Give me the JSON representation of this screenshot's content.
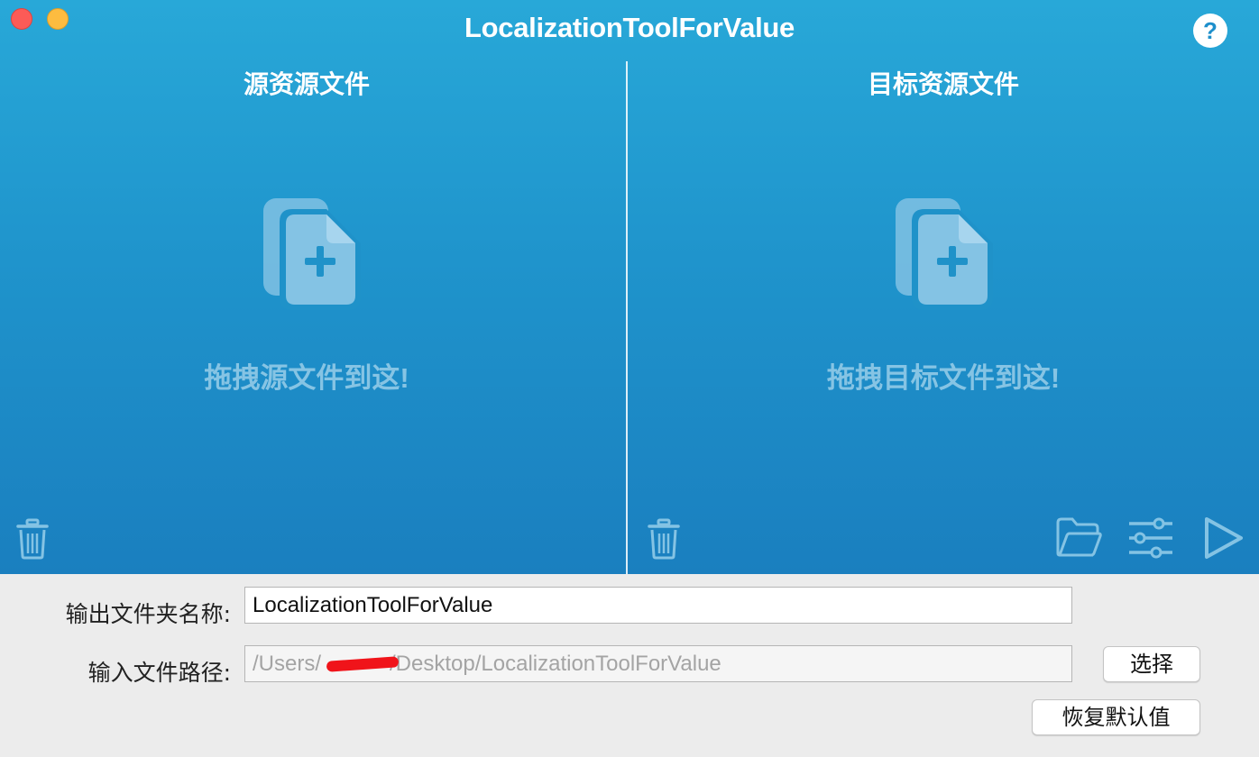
{
  "window": {
    "title": "LocalizationToolForValue",
    "help_label": "?"
  },
  "icons": {
    "close": "close-traffic-light",
    "minimize": "minimize-traffic-light",
    "help": "question-mark-icon",
    "add_file": "add-files-icon",
    "trash": "trash-icon",
    "folder": "folder-icon",
    "settings": "sliders-icon",
    "run": "play-icon"
  },
  "source_pane": {
    "title": "源资源文件",
    "drop_hint": "拖拽源文件到这!"
  },
  "target_pane": {
    "title": "目标资源文件",
    "drop_hint": "拖拽目标文件到这!"
  },
  "form": {
    "output_folder_label": "输出文件夹名称:",
    "output_folder_value": "LocalizationToolForValue",
    "input_path_label": "输入文件路径:",
    "input_path_prefix": "/Users/",
    "input_path_suffix": "/Desktop/LocalizationToolForValue",
    "choose_button": "选择",
    "reset_button": "恢复默认值"
  },
  "colors": {
    "accent_top": "#28a8d8",
    "accent_bottom": "#1a7fbf",
    "close_button": "#fc5b57",
    "minimize_button": "#fdbc40",
    "redaction": "#f0141a"
  }
}
